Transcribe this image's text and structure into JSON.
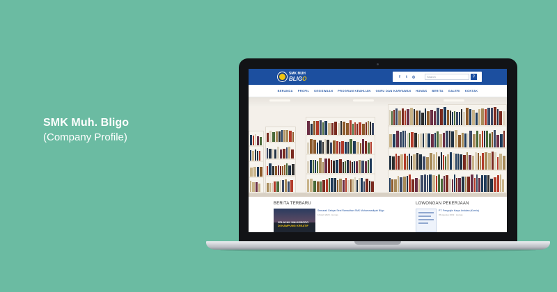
{
  "caption": {
    "name": "SMK Muh. Bligo",
    "sub": "(Company Profile)"
  },
  "site": {
    "logo_line1": "SMK MUH",
    "logo_line2a": "BLIG",
    "logo_line2b": "O",
    "social_icons": [
      "facebook-icon",
      "twitter-icon",
      "instagram-icon"
    ],
    "social_glyphs": [
      "f",
      "t",
      "◎"
    ],
    "search_placeholder": "Search",
    "search_glyph": "⚲"
  },
  "nav": {
    "items": [
      "BERANDA",
      "PROFIL",
      "KESISWAAN",
      "PROGRAM KEAHLIAN",
      "GURU DAN KARYAWAN",
      "HUMAS",
      "BERITA",
      "GALERI",
      "KONTAK"
    ]
  },
  "sections": {
    "news_title": "BERITA TERBARU",
    "jobs_title": "LOWONGAN PEKERJAAN",
    "news_post": {
      "title": "Semarak Gebyar Seni Ramadhan SMK Muhammadiyah Bligo",
      "meta": "16 April 2020 · Humas",
      "thumb_line1": "JELAJAH MALIOBORO",
      "thumb_line2": "DI KAMPUNG",
      "thumb_line3": "KREATIF"
    },
    "job_post": {
      "title": "PT. Pengrajin Karya Andalan (Kurnia)",
      "meta": "05 Agustus 2019 · Humas"
    }
  },
  "colors": {
    "background": "#6bbba2",
    "site_header": "#1c4f9f",
    "accent": "#f1c40f"
  }
}
